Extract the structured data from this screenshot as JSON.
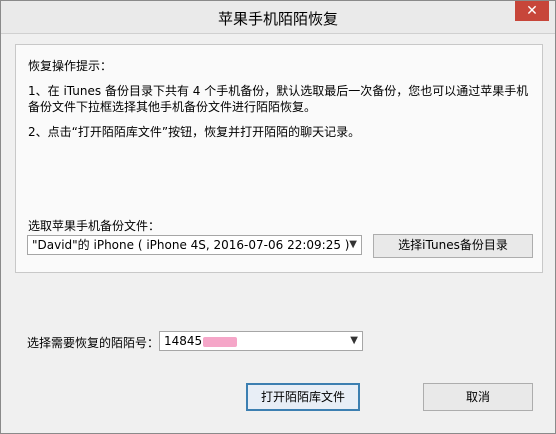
{
  "window": {
    "title": "苹果手机陌陌恢复"
  },
  "hints": {
    "title": "恢复操作提示：",
    "line1": "1、在 iTunes 备份目录下共有 4 个手机备份，默认选取最后一次备份，您也可以通过苹果手机备份文件下拉框选择其他手机备份文件进行陌陌恢复。",
    "line2": "2、点击“打开陌陌库文件”按钮，恢复并打开陌陌的聊天记录。"
  },
  "backup": {
    "label": "选取苹果手机备份文件：",
    "selected": "\"David\"的 iPhone ( iPhone 4S, 2016-07-06 22:09:25 )",
    "choose_dir_label": "选择iTunes备份目录"
  },
  "momo": {
    "label": "选择需要恢复的陌陌号：",
    "selected_prefix": "14845"
  },
  "buttons": {
    "open_label": "打开陌陌库文件",
    "cancel_label": "取消"
  },
  "colors": {
    "close_button": "#c7463a",
    "focus_border": "#3c7fb1"
  }
}
